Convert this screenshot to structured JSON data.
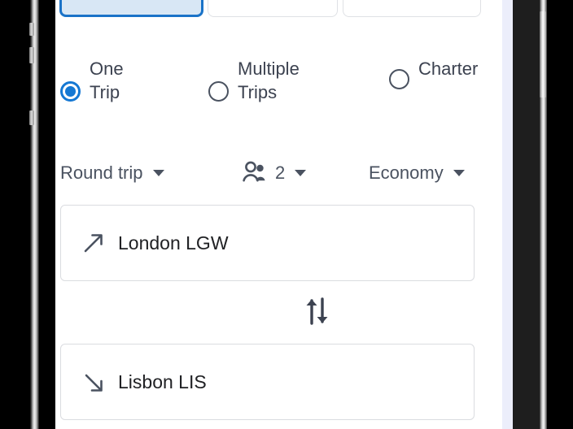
{
  "app": {
    "screen_name": "flight-search-form"
  },
  "tabs": [
    {
      "label": "",
      "icon": "tab-indicator",
      "selected": true,
      "name": "tab-flights"
    },
    {
      "label": "",
      "icon": "tab-indicator",
      "selected": false,
      "name": "tab-second"
    },
    {
      "label": "...",
      "icon": "tab-indicator",
      "selected": false,
      "name": "tab-third"
    }
  ],
  "trip_type": {
    "options": [
      {
        "label": "One\nTrip",
        "selected": true,
        "name": "radio-one-trip"
      },
      {
        "label": "Multiple\nTrips",
        "selected": false,
        "name": "radio-multiple-trips"
      },
      {
        "label": "Charter",
        "selected": false,
        "name": "radio-charter"
      }
    ]
  },
  "selectors": {
    "trip_mode": "Round trip",
    "passengers": "2",
    "passengers_icon": "people-icon",
    "cabin_class": "Economy",
    "caret_icon": "chevron-down-icon"
  },
  "route": {
    "origin": {
      "value": "London LGW",
      "icon": "arrow-up-right-icon"
    },
    "destination": {
      "value": "Lisbon LIS",
      "icon": "arrow-down-right-icon"
    },
    "swap_icon": "swap-vertical-icon"
  },
  "colors": {
    "accent_blue": "#1578d3",
    "tab_selected_fill": "#d8e7f5",
    "tab_selected_border": "#1a73c8",
    "text_primary": "#202124",
    "text_secondary": "#4a5260",
    "field_border": "#dadce0",
    "screen_bg": "#ffffff",
    "gutter": "#eceefb"
  }
}
